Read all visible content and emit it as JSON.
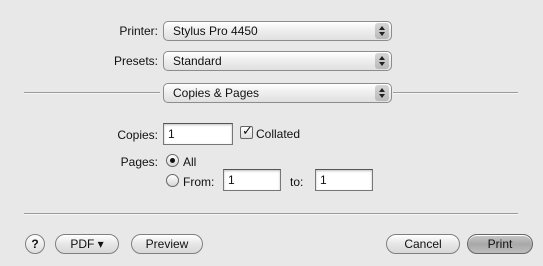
{
  "printer": {
    "label": "Printer:",
    "value": "Stylus Pro 4450"
  },
  "presets": {
    "label": "Presets:",
    "value": "Standard"
  },
  "panel": {
    "value": "Copies & Pages"
  },
  "copies": {
    "label": "Copies:",
    "value": "1",
    "collated_label": "Collated",
    "collated_checked": true
  },
  "pages": {
    "label": "Pages:",
    "all_label": "All",
    "from_label": "From:",
    "from_value": "1",
    "to_label": "to:",
    "to_value": "1",
    "selected": "all"
  },
  "footer": {
    "help_label": "?",
    "pdf_label": "PDF ▾",
    "preview_label": "Preview",
    "cancel_label": "Cancel",
    "print_label": "Print"
  }
}
